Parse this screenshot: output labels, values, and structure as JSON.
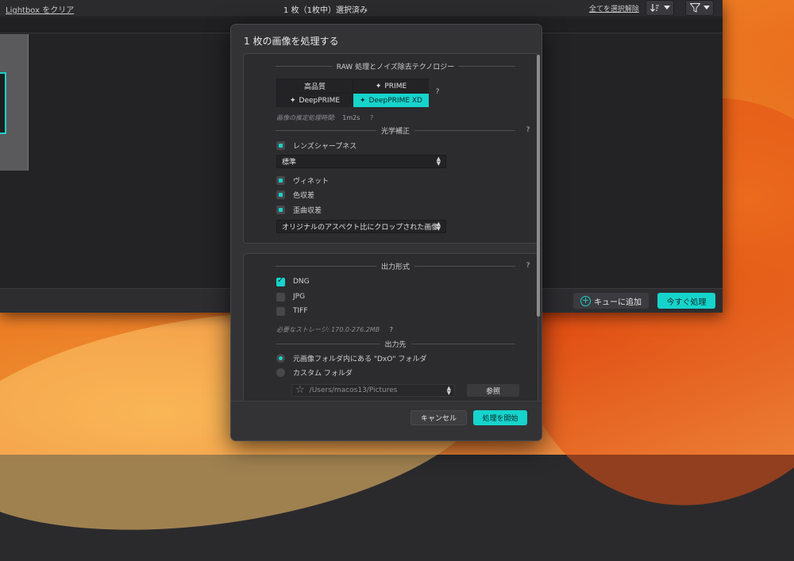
{
  "topbar": {
    "clear_lightbox": "Lightbox をクリア",
    "selection_status": "1 枚（1枚中）選択済み",
    "deselect_all": "全てを選択解除",
    "sort_icon": "sort-icon",
    "filter_icon": "filter-icon"
  },
  "bottombar": {
    "add_to_queue": "キューに追加",
    "process_now": "今すぐ処理"
  },
  "dialog": {
    "title": "1 枚の画像を処理する",
    "raw_section": {
      "heading": "RAW 処理とノイズ除去テクノロジー",
      "options": [
        {
          "label": "高品質",
          "active": false
        },
        {
          "label": "PRIME",
          "active": false
        },
        {
          "label": "DeepPRIME",
          "active": false
        },
        {
          "label": "DeepPRIME XD",
          "active": true
        }
      ],
      "help": "?",
      "estimate_label": "画像の推定処理時間:",
      "estimate_value": "1m2s"
    },
    "optical_section": {
      "heading": "光学補正",
      "lens_sharpness": "レンズシャープネス",
      "sharpness_value": "標準",
      "vignetting": "ヴィネット",
      "chromatic_aberration": "色収差",
      "distortion": "歪曲収差",
      "crop_value": "オリジナルのアスペクト比にクロップされた画像"
    },
    "output_section": {
      "heading": "出力形式",
      "formats": [
        {
          "label": "DNG",
          "checked": true
        },
        {
          "label": "JPG",
          "checked": false
        },
        {
          "label": "TIFF",
          "checked": false
        }
      ],
      "storage_label": "必要なストレージ:",
      "storage_value": "170.0-276.2MB"
    },
    "destination_section": {
      "heading": "出力先",
      "option_original": "元画像フォルダ内にある \"DxO\" フォルダ",
      "option_custom": "カスタム フォルダ",
      "path": "/Users/macos13/Pictures",
      "browse": "参照"
    },
    "footer": {
      "cancel": "キャンセル",
      "start": "処理を開始"
    }
  },
  "colors": {
    "accent": "#16d4cc",
    "dialog_bg": "#333336",
    "panel_bg": "#2c2c2f"
  }
}
